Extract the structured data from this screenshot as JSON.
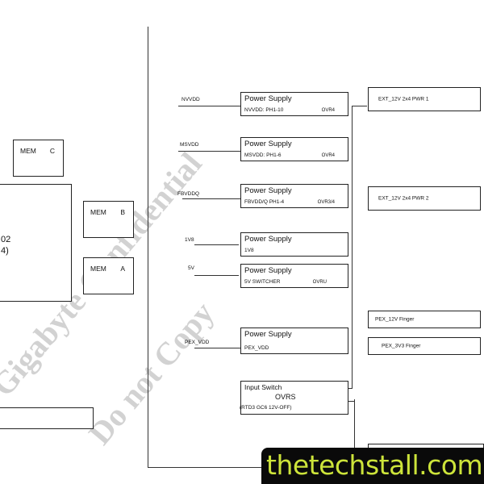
{
  "left": {
    "gpu_text_line1": "02",
    "gpu_text_line2": "4)",
    "mem_c": {
      "label": "MEM",
      "letter": "C"
    },
    "mem_b": {
      "label": "MEM",
      "letter": "B"
    },
    "mem_a": {
      "label": "MEM",
      "letter": "A"
    }
  },
  "power_supplies": [
    {
      "rail": "NVVDD",
      "title": "Power Supply",
      "sub": "NVVDD: PH1-10",
      "ovr": "OVR4"
    },
    {
      "rail": "MSVDD",
      "title": "Power Supply",
      "sub": "MSVDD: PH1-6",
      "ovr": "OVR4"
    },
    {
      "rail": "FBVDDQ",
      "title": "Power Supply",
      "sub": "FBVDD/Q PH1-4",
      "ovr": "OVR3/4"
    },
    {
      "rail": "1V8",
      "title": "Power Supply",
      "sub": "1V8",
      "ovr": ""
    },
    {
      "rail": "5V",
      "title": "Power Supply",
      "sub": "5V SWITCHER",
      "ovr": "OVRU"
    },
    {
      "rail": "PEX_VDD",
      "title": "Power Supply",
      "sub": "PEX_VDD",
      "ovr": ""
    }
  ],
  "input_switch": {
    "title": "Input Switch",
    "part": "OVRS",
    "note": "(RTD3 GC6 12V-OFF)"
  },
  "connectors": [
    {
      "label": "EXT_12V 2x4 PWR 1"
    },
    {
      "label": "EXT_12V 2x4 PWR 2"
    },
    {
      "label": "PEX_12V Finger"
    },
    {
      "label": "PEX_3V3 Finger"
    }
  ],
  "watermark": {
    "line1": "Gigabyte Confidential",
    "line2": "Do not Copy"
  },
  "banner": {
    "text": "thetechstall.com",
    "text_color": "#cde43a",
    "bg_color": "#0a0a0a"
  }
}
